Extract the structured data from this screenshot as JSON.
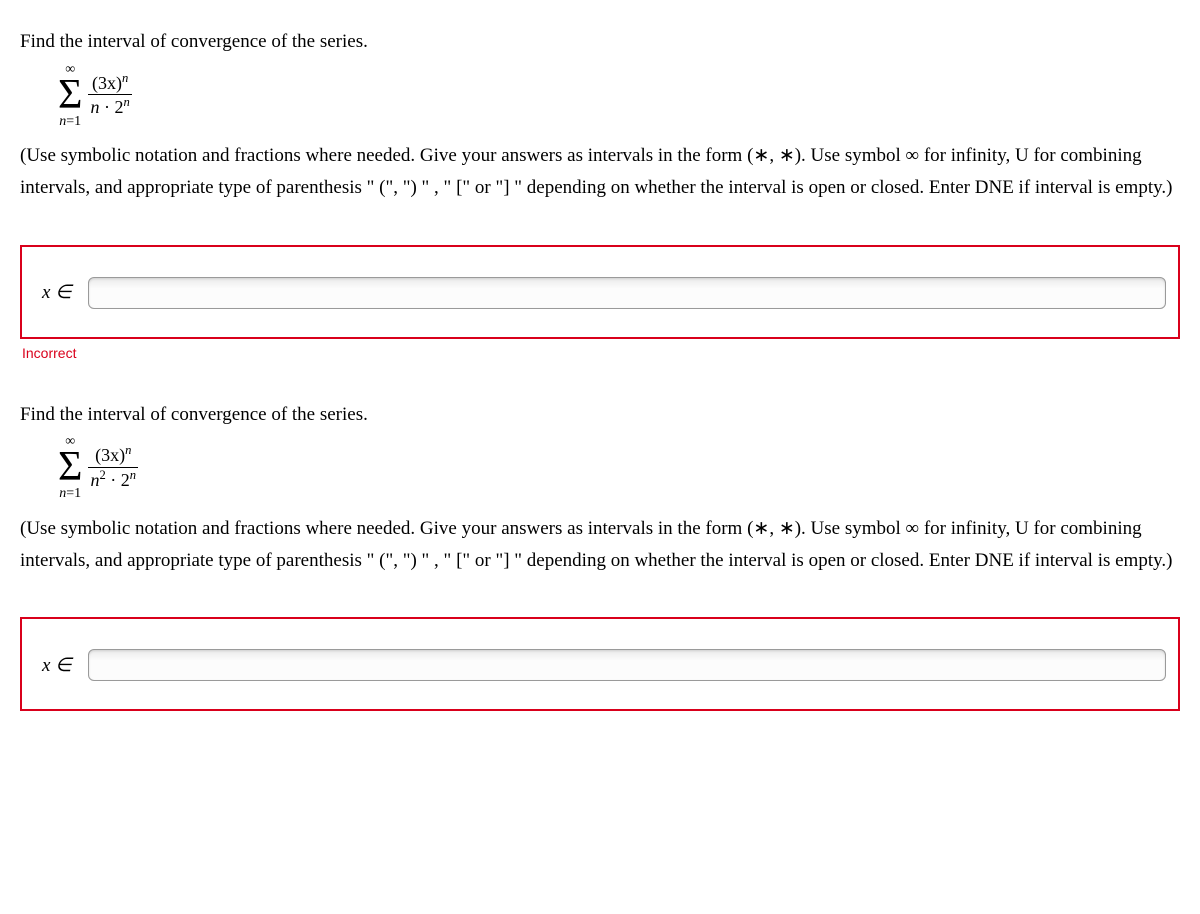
{
  "question1": {
    "prompt": "Find the interval of convergence of the series.",
    "sigma_top": "∞",
    "sigma_bottom_var": "n",
    "sigma_bottom_eq": "=1",
    "numerator_base": "(3x)",
    "numerator_exp": "n",
    "denominator_left": "n",
    "denominator_mid": " · 2",
    "denominator_exp": "n",
    "instructions": "(Use symbolic notation and fractions where needed. Give your answers as intervals in the form (∗, ∗). Use symbol ∞ for infinity, U for combining intervals, and appropriate type of parenthesis \" (\", \") \" ,  \" [\" or \"] \" depending on whether the interval is open or closed. Enter DNE if interval is empty.)",
    "answer_label": "x ∈",
    "answer_value": "",
    "feedback": "Incorrect"
  },
  "question2": {
    "prompt": "Find the interval of convergence of the series.",
    "sigma_top": "∞",
    "sigma_bottom_var": "n",
    "sigma_bottom_eq": "=1",
    "numerator_base": "(3x)",
    "numerator_exp": "n",
    "denominator_left": "n",
    "denominator_leftexp": "2",
    "denominator_mid": " · 2",
    "denominator_exp": "n",
    "instructions": "(Use symbolic notation and fractions where needed. Give your answers as intervals in the form (∗, ∗). Use symbol ∞ for infinity, U for combining intervals, and appropriate type of parenthesis \" (\", \") \" ,  \" [\" or \"] \" depending on whether the interval is open or closed. Enter DNE if interval is empty.)",
    "answer_label": "x ∈",
    "answer_value": ""
  }
}
